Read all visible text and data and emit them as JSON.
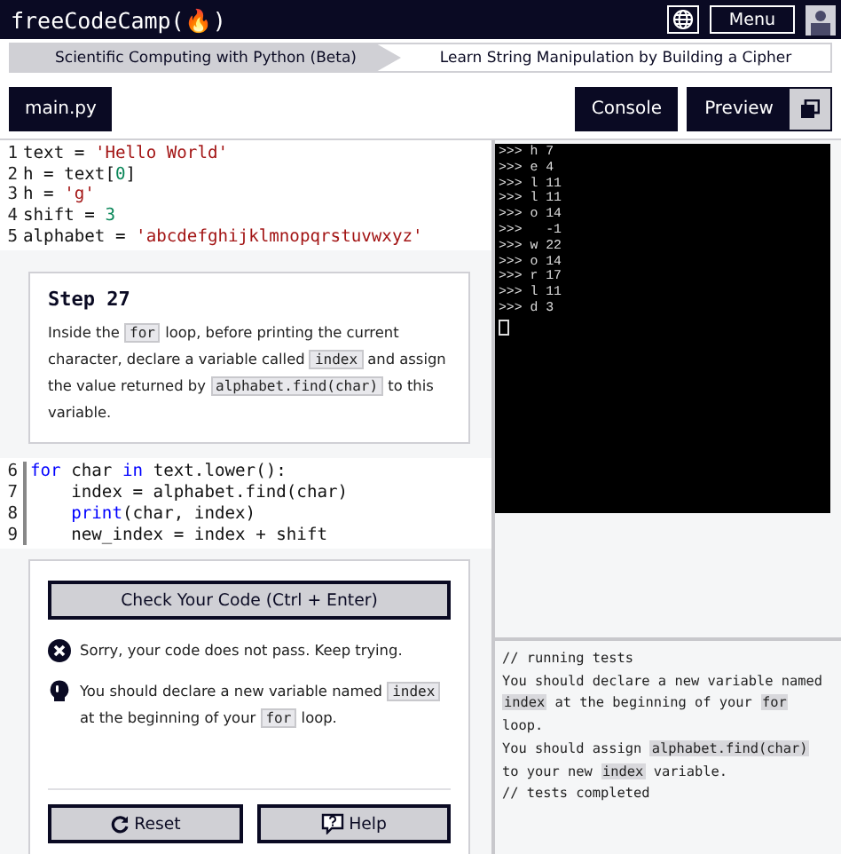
{
  "navbar": {
    "logo": "freeCodeCamp(🔥)",
    "menu_button": "Menu"
  },
  "breadcrumbs": [
    {
      "label": "Scientific Computing with Python (Beta)",
      "selected": true
    },
    {
      "label": "Learn String Manipulation by Building a Cipher",
      "selected": false
    }
  ],
  "file_tab": "main.py",
  "console_button": "Console",
  "preview_button": "Preview",
  "code_top": [
    {
      "number": "1",
      "tokens": [
        {
          "text": "text = ",
          "kind": "plain"
        },
        {
          "text": "'Hello World'",
          "kind": "string"
        }
      ]
    },
    {
      "number": "2",
      "tokens": [
        {
          "text": "h = text[",
          "kind": "plain"
        },
        {
          "text": "0",
          "kind": "number"
        },
        {
          "text": "]",
          "kind": "plain"
        }
      ]
    },
    {
      "number": "3",
      "tokens": [
        {
          "text": "h = ",
          "kind": "plain"
        },
        {
          "text": "'g'",
          "kind": "string"
        }
      ]
    },
    {
      "number": "4",
      "tokens": [
        {
          "text": "shift = ",
          "kind": "plain"
        },
        {
          "text": "3",
          "kind": "number"
        }
      ]
    },
    {
      "number": "5",
      "tokens": [
        {
          "text": "alphabet = ",
          "kind": "plain"
        },
        {
          "text": "'abcdefghijklmnopqrstuvwxyz'",
          "kind": "string"
        }
      ]
    }
  ],
  "step": {
    "title": "Step 27",
    "description": [
      {
        "text": "Inside the ",
        "kind": "text"
      },
      {
        "text": "for",
        "kind": "code"
      },
      {
        "text": " loop, before printing the current character, declare a variable called ",
        "kind": "text"
      },
      {
        "text": "index",
        "kind": "code"
      },
      {
        "text": " and assign the value returned by ",
        "kind": "text"
      },
      {
        "text": "alphabet.find(char)",
        "kind": "code"
      },
      {
        "text": " to this variable.",
        "kind": "text"
      }
    ]
  },
  "code_bottom": [
    {
      "number": "6",
      "tokens": [
        {
          "text": "for",
          "kind": "keyword"
        },
        {
          "text": " char ",
          "kind": "plain"
        },
        {
          "text": "in",
          "kind": "keyword"
        },
        {
          "text": " text.lower():",
          "kind": "plain"
        }
      ]
    },
    {
      "number": "7",
      "tokens": [
        {
          "text": "    index = alphabet.find(char)",
          "kind": "plain"
        }
      ]
    },
    {
      "number": "8",
      "tokens": [
        {
          "text": "    print",
          "kind": "keyword"
        },
        {
          "text": "(char, index)",
          "kind": "plain"
        }
      ]
    },
    {
      "number": "9",
      "tokens": [
        {
          "text": "    new_index = index + shift",
          "kind": "plain"
        }
      ]
    }
  ],
  "check_button": "Check Your Code (Ctrl + Enter)",
  "messages": [
    {
      "kind": "error",
      "parts": [
        {
          "text": "Sorry, your code does not pass. Keep trying.",
          "kind": "text"
        }
      ]
    },
    {
      "kind": "hint",
      "parts": [
        {
          "text": "You should declare a new variable named ",
          "kind": "text"
        },
        {
          "text": "index",
          "kind": "code"
        },
        {
          "text": " at the beginning of your ",
          "kind": "text"
        },
        {
          "text": "for",
          "kind": "code"
        },
        {
          "text": " loop.",
          "kind": "text"
        }
      ]
    }
  ],
  "reset_button": "Reset",
  "help_button": "Help",
  "console_lines": [
    ">>> h 7",
    ">>> e 4",
    ">>> l 11",
    ">>> l 11",
    ">>> o 14",
    ">>>   -1",
    ">>> w 22",
    ">>> o 14",
    ">>> r 17",
    ">>> l 11",
    ">>> d 3"
  ],
  "test_output": [
    [
      {
        "text": "// running tests",
        "kind": "text"
      }
    ],
    [
      {
        "text": "You should declare a new variable named ",
        "kind": "text"
      },
      {
        "text": "index",
        "kind": "code"
      },
      {
        "text": " at the beginning of your ",
        "kind": "text"
      },
      {
        "text": "for",
        "kind": "code"
      },
      {
        "text": " loop.",
        "kind": "text"
      }
    ],
    [
      {
        "text": "You should assign ",
        "kind": "text"
      },
      {
        "text": "alphabet.find(char)",
        "kind": "code"
      },
      {
        "text": " to your new ",
        "kind": "text"
      },
      {
        "text": "index",
        "kind": "code"
      },
      {
        "text": " variable.",
        "kind": "text"
      }
    ],
    [
      {
        "text": "// tests completed",
        "kind": "text"
      }
    ]
  ]
}
